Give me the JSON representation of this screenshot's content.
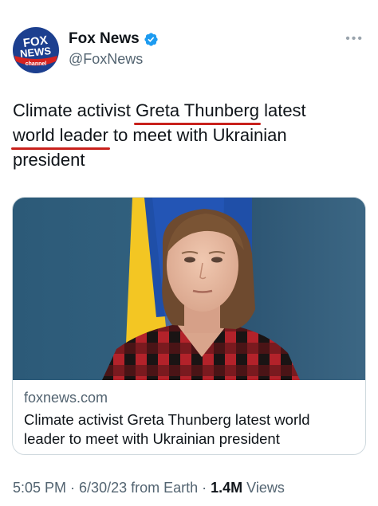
{
  "author": {
    "name": "Fox News",
    "handle": "@FoxNews",
    "logo_line1": "FOX",
    "logo_line2": "NEWS",
    "logo_line3": "channel",
    "verified": true
  },
  "tweet": {
    "text_1": "Climate activist ",
    "text_ul_1": "Greta Thunberg",
    "text_2": " latest",
    "text_ul_2": "world leader",
    "text_3": " to meet with Ukrainian president"
  },
  "card": {
    "domain": "foxnews.com",
    "title": "Climate activist Greta Thunberg latest world leader to meet with Ukrainian president"
  },
  "footer": {
    "time": "5:05 PM",
    "sep1": " · ",
    "date": "6/30/23",
    "source": " from Earth",
    "sep2": " · ",
    "views_count": "1.4M",
    "views_label": " Views"
  },
  "colors": {
    "underline": "#c8211c",
    "verified": "#1d9bf0",
    "secondary_text": "#536471"
  }
}
